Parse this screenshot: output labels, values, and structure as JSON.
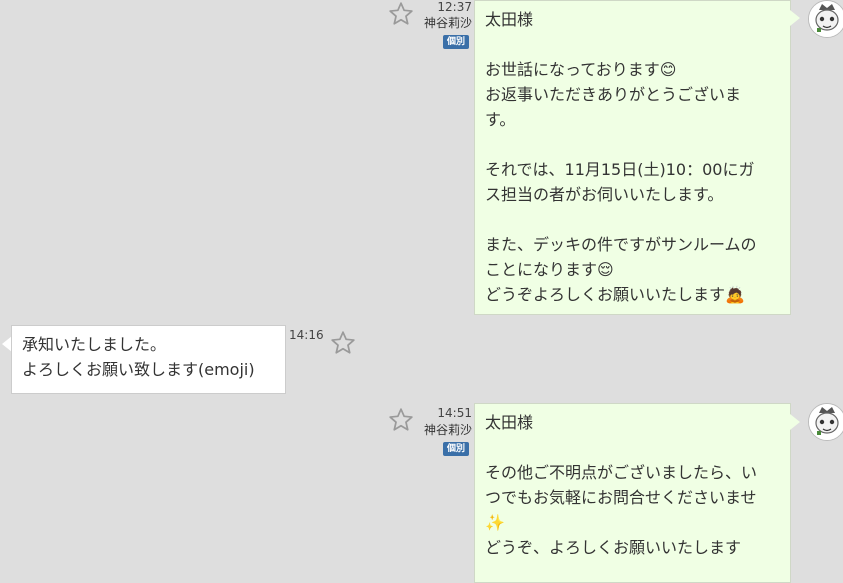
{
  "messages": [
    {
      "time": "12:37",
      "sender": "神谷莉沙",
      "badge": "個別",
      "text": "太田様\n\nお世話になっております😊\nお返事いただきありがとうございま\nす。\n\nそれでは、11月15日(土)10：00にガ\nス担当の者がお伺いいたします。\n\nまた、デッキの件ですがサンルームの\nことになります😌\nどうぞよろしくお願いいたします🙇"
    },
    {
      "time": "14:16",
      "text": "承知いたしました。\nよろしくお願い致します(emoji)"
    },
    {
      "time": "14:51",
      "sender": "神谷莉沙",
      "badge": "個別",
      "text": "太田様\n\nその他ご不明点がございましたら、い\nつでもお気軽にお問合せくださいませ\n✨\nどうぞ、よろしくお願いいたします"
    }
  ],
  "colors": {
    "background": "#dedede",
    "outgoing_bubble": "#f0ffe4",
    "incoming_bubble": "#ffffff",
    "badge": "#3a6fa8",
    "star": "#9a9a9a"
  },
  "icons": {
    "star": "star-icon",
    "avatar": "user-avatar"
  }
}
